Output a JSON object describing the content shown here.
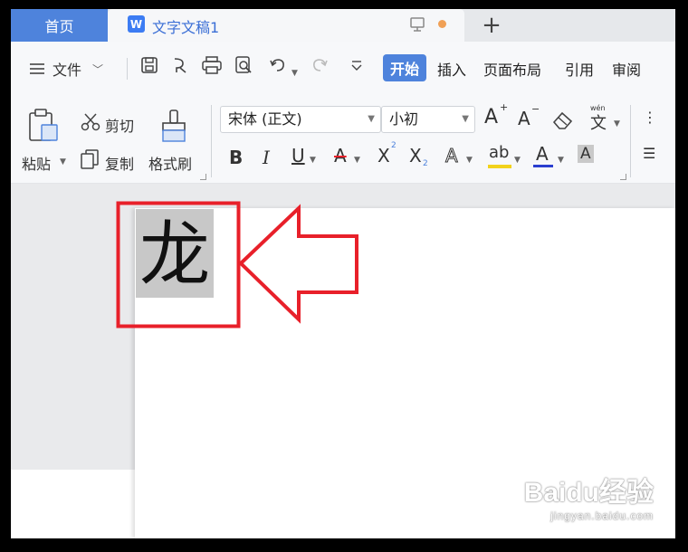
{
  "tabs": {
    "home": "首页",
    "document": "文字文稿1",
    "logo_letter": "W",
    "new_tab": "+"
  },
  "toolbar": {
    "file_menu": "文件",
    "ribbon_tabs": [
      "开始",
      "插入",
      "页面布局",
      "引用",
      "审阅"
    ],
    "active_tab": "开始"
  },
  "ribbon": {
    "paste": "粘贴",
    "cut": "剪切",
    "copy": "复制",
    "format_painter": "格式刷",
    "font_name": "宋体 (正文)",
    "font_size": "小初",
    "bold": "B",
    "italic": "I",
    "underline": "U",
    "strike": "A",
    "superscript": "X",
    "subscript": "X",
    "grow": "A",
    "shrink": "A",
    "text_effect": "A",
    "highlight": "ab",
    "font_color": "A",
    "char_shade": "A",
    "phonetic": "文",
    "pinyin_hint": "wén"
  },
  "document": {
    "selected_text": "龙"
  },
  "watermark": {
    "brand": "Baidu经验",
    "url": "jingyan.baidu.com"
  },
  "colors": {
    "accent": "#4e83dc",
    "annotation": "#e8202a",
    "highlight_bar": "#f2d21b",
    "font_color_bar": "#2b3fd0",
    "selection": "#c8c8c8"
  }
}
